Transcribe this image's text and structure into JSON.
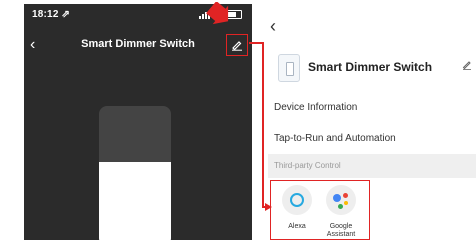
{
  "left_screen": {
    "status_time": "18:12 ⇗",
    "title": "Smart Dimmer Switch",
    "dimmer_level_fraction": 0.6
  },
  "right_screen": {
    "device_name": "Smart Dimmer Switch",
    "menu_items": [
      {
        "label": "Device Information"
      },
      {
        "label": "Tap-to-Run and Automation"
      }
    ],
    "section_label": "Third-party Control",
    "assistants": [
      {
        "label": "Alexa"
      },
      {
        "label": "Google Assistant"
      }
    ]
  },
  "colors": {
    "annotation": "#e02424",
    "left_background": "#2b2b2b",
    "alexa_blue": "#27a9e0",
    "google_blue": "#4285f4",
    "google_red": "#ea4335",
    "google_yellow": "#fbbc05",
    "google_green": "#34a853"
  },
  "icons": [
    "back-chevron-icon",
    "edit-pencil-icon",
    "wifi-icon",
    "battery-icon",
    "alexa-icon",
    "google-assistant-icon",
    "device-switch-icon"
  ]
}
